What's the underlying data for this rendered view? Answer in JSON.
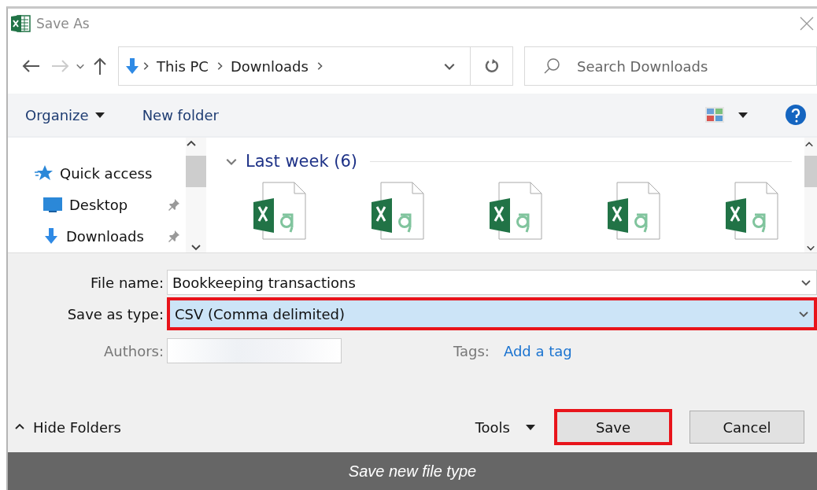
{
  "window": {
    "title": "Save As"
  },
  "address": {
    "path": [
      "This PC",
      "Downloads"
    ]
  },
  "search": {
    "placeholder": "Search Downloads"
  },
  "toolbar": {
    "organize": "Organize",
    "new_folder": "New folder"
  },
  "nav": {
    "items": [
      {
        "label": "Quick access",
        "kind": "star",
        "pinned": false
      },
      {
        "label": "Desktop",
        "kind": "desktop",
        "pinned": true
      },
      {
        "label": "Downloads",
        "kind": "download",
        "pinned": true
      }
    ]
  },
  "files": {
    "group": "Last week (6)",
    "expanded": true,
    "items": [
      {
        "kind": "excel-csv"
      },
      {
        "kind": "excel-csv"
      },
      {
        "kind": "excel-csv"
      },
      {
        "kind": "excel-csv"
      },
      {
        "kind": "excel-csv"
      }
    ]
  },
  "form": {
    "fields": [
      {
        "label": "File name:",
        "value": "Bookkeeping transactions",
        "kind": "combo",
        "highlighted": false
      },
      {
        "label": "Save as type:",
        "value": "CSV (Comma delimited)",
        "kind": "select",
        "highlighted": true
      }
    ],
    "authors": {
      "label": "Authors:"
    },
    "tags": {
      "label": "Tags:",
      "link": "Add a tag"
    }
  },
  "footer": {
    "hide_folders": "Hide Folders",
    "tools": "Tools",
    "buttons": [
      {
        "label": "Save",
        "highlighted": true
      },
      {
        "label": "Cancel",
        "highlighted": false
      }
    ]
  },
  "caption": "Save new file type"
}
